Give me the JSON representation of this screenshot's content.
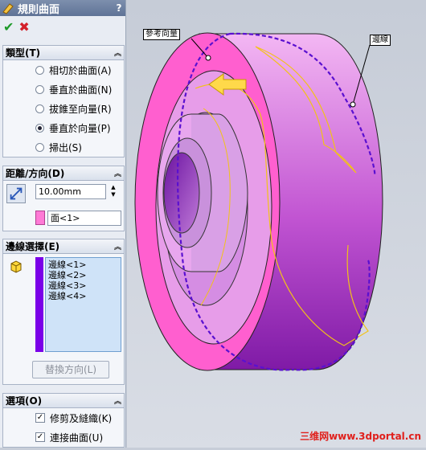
{
  "panel": {
    "title": "規則曲面",
    "help_label": "?",
    "ok_label": "✔",
    "cancel_label": "✖",
    "type_group": {
      "title": "類型(T)",
      "options": [
        {
          "label": "相切於曲面(A)",
          "selected": false
        },
        {
          "label": "垂直於曲面(N)",
          "selected": false
        },
        {
          "label": "拔錐至向量(R)",
          "selected": false
        },
        {
          "label": "垂直於向量(P)",
          "selected": true
        },
        {
          "label": "掃出(S)",
          "selected": false
        }
      ]
    },
    "distance_group": {
      "title": "距離/方向(D)",
      "distance_value": "10.00mm",
      "face_value": "面<1>"
    },
    "edge_group": {
      "title": "邊線選擇(E)",
      "edges": [
        "邊線<1>",
        "邊線<2>",
        "邊線<3>",
        "邊線<4>"
      ],
      "swap_button": "替換方向(L)"
    },
    "options_group": {
      "title": "選項(O)",
      "trim_label": "修剪及縫織(K)",
      "connect_label": "連接曲面(U)"
    }
  },
  "viewport": {
    "reference_label": "參考向量",
    "edge_label": "邊線",
    "watermark": "三维网www.3dportal.cn",
    "colors": {
      "face_pink": "#ff5fcf",
      "body_purple": "#c85bd8",
      "dark_purple": "#7a14a0",
      "edge_dash": "#5a10d0",
      "curve_yellow": "#f2c218"
    }
  }
}
